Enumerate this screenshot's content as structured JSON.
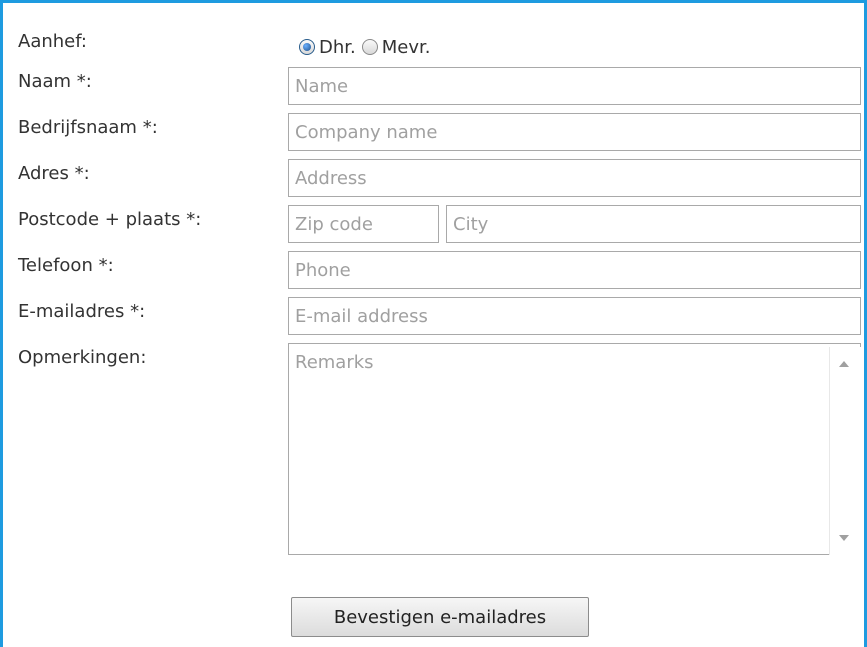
{
  "form": {
    "salutation": {
      "label": "Aanhef:",
      "options": [
        {
          "label": "Dhr.",
          "checked": true
        },
        {
          "label": "Mevr.",
          "checked": false
        }
      ]
    },
    "name": {
      "label": "Naam *:",
      "placeholder": "Name",
      "value": ""
    },
    "company": {
      "label": "Bedrijfsnaam *:",
      "placeholder": "Company name",
      "value": ""
    },
    "address": {
      "label": "Adres *:",
      "placeholder": "Address",
      "value": ""
    },
    "zip_city": {
      "label": "Postcode + plaats *:",
      "zip_placeholder": "Zip code",
      "city_placeholder": "City"
    },
    "phone": {
      "label": "Telefoon *:",
      "placeholder": "Phone",
      "value": ""
    },
    "email": {
      "label": "E-mailadres *:",
      "placeholder": "E-mail address",
      "value": ""
    },
    "remarks": {
      "label": "Opmerkingen:",
      "placeholder": "Remarks",
      "value": ""
    },
    "submit_label": "Bevestigen e-mailadres"
  },
  "colors": {
    "frame_border": "#1e9be0",
    "field_border": "#a9a9a9",
    "placeholder_text": "#a0a0a0",
    "label_text": "#333333"
  },
  "icons": [
    "radio-checked-icon",
    "radio-unchecked-icon",
    "scroll-up-arrow-icon",
    "scroll-down-arrow-icon"
  ]
}
